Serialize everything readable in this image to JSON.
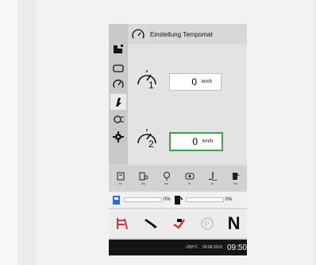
{
  "header": {
    "title": "Einstellung Tempomat"
  },
  "settings": [
    {
      "index": "1",
      "value": "0",
      "unit": "km/h"
    },
    {
      "index": "2",
      "value": "0",
      "unit": "km/h"
    }
  ],
  "sidebar": {
    "items": [
      {
        "icon": "vehicle-icon"
      },
      {
        "icon": "engine-icon"
      },
      {
        "icon": "speedometer-icon"
      },
      {
        "icon": "hydraulic-icon"
      },
      {
        "icon": "pto-icon"
      },
      {
        "icon": "settings-gear-icon"
      }
    ]
  },
  "indicators": [
    {
      "icon": "filter-icon",
      "label": "0r"
    },
    {
      "icon": "filter-2-icon",
      "label": "0w"
    },
    {
      "icon": "lamp-icon",
      "label": "0w"
    },
    {
      "icon": "engine-warn-icon",
      "label": "0r"
    },
    {
      "icon": "coolant-icon",
      "label": "0r"
    },
    {
      "icon": "fuel-icon",
      "label": "0w"
    }
  ],
  "levels": {
    "def": {
      "percent": "0%",
      "fraction": 0
    },
    "fuel": {
      "percent": "0%",
      "fraction": 0
    }
  },
  "status": {
    "gear": "N",
    "icons": [
      "seatbelt-icon",
      "wrench-icon",
      "engine-fault-icon",
      "parking-brake-icon"
    ]
  },
  "footer": {
    "temp": "-250°C",
    "date": "09.08.2019",
    "time": "09:50"
  },
  "colors": {
    "selected_border": "#3aa64a",
    "alert_red": "#e0303c",
    "def_blue": "#2d6fd6"
  }
}
